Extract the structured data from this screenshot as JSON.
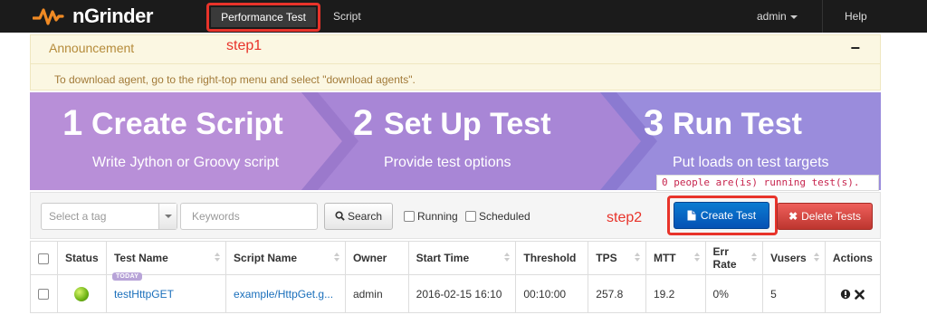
{
  "app": {
    "name": "nGrinder"
  },
  "nav": {
    "performance_test": "Performance Test",
    "script": "Script",
    "user": "admin",
    "help": "Help"
  },
  "announcement": {
    "title": "Announcement",
    "text": "To download agent, go to the right-top menu and select \"download agents\".",
    "toggle": "−"
  },
  "annotations": {
    "step1": "step1",
    "step2": "step2"
  },
  "steps": [
    {
      "num": "1",
      "title": "Create Script",
      "sub": "Write Jython or Groovy script"
    },
    {
      "num": "2",
      "title": "Set Up Test",
      "sub": "Provide test options"
    },
    {
      "num": "3",
      "title": "Run Test",
      "sub": "Put loads on test targets"
    }
  ],
  "running_msg": "0 people are(is) running test(s).",
  "toolbar": {
    "tag_placeholder": "Select a tag",
    "keywords_placeholder": "Keywords",
    "search": "Search",
    "running": "Running",
    "scheduled": "Scheduled",
    "create": "Create Test",
    "delete": "Delete Tests"
  },
  "table": {
    "headers": [
      "Status",
      "Test Name",
      "Script Name",
      "Owner",
      "Start Time",
      "Threshold",
      "TPS",
      "MTT",
      "Err Rate",
      "Vusers",
      "Actions"
    ],
    "rows": [
      {
        "badge": "TODAY",
        "status": "running-ok",
        "name": "testHttpGET",
        "script": "example/HttpGet.g...",
        "owner": "admin",
        "start": "2016-02-15 16:10",
        "threshold": "00:10:00",
        "tps": "257.8",
        "mtt": "19.2",
        "err": "0%",
        "vusers": "5"
      }
    ]
  },
  "colors": {
    "accent_red": "#e8332a",
    "primary_blue": "#0552b5",
    "danger": "#bd362f",
    "logo_orange": "#f08a24"
  }
}
